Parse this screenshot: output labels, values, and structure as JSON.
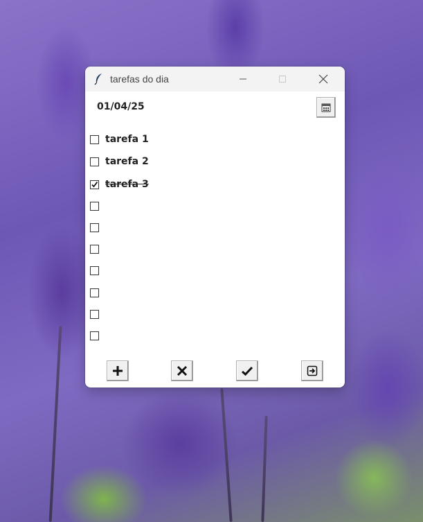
{
  "window": {
    "title": "tarefas do dia",
    "controls": [
      "minimize-icon",
      "maximize-icon",
      "close-icon"
    ]
  },
  "header": {
    "date": "01/04/25",
    "calendar_button_icon": "calendar-icon"
  },
  "tasks": [
    {
      "label": "tarefa 1",
      "checked": false
    },
    {
      "label": "tarefa 2",
      "checked": false
    },
    {
      "label": "tarefa 3",
      "checked": true
    },
    {
      "label": "",
      "checked": false
    },
    {
      "label": "",
      "checked": false
    },
    {
      "label": "",
      "checked": false
    },
    {
      "label": "",
      "checked": false
    },
    {
      "label": "",
      "checked": false
    },
    {
      "label": "",
      "checked": false
    },
    {
      "label": "",
      "checked": false
    }
  ],
  "toolbar": {
    "buttons": [
      "plus-icon",
      "x-icon",
      "check-icon",
      "exit-icon"
    ]
  }
}
